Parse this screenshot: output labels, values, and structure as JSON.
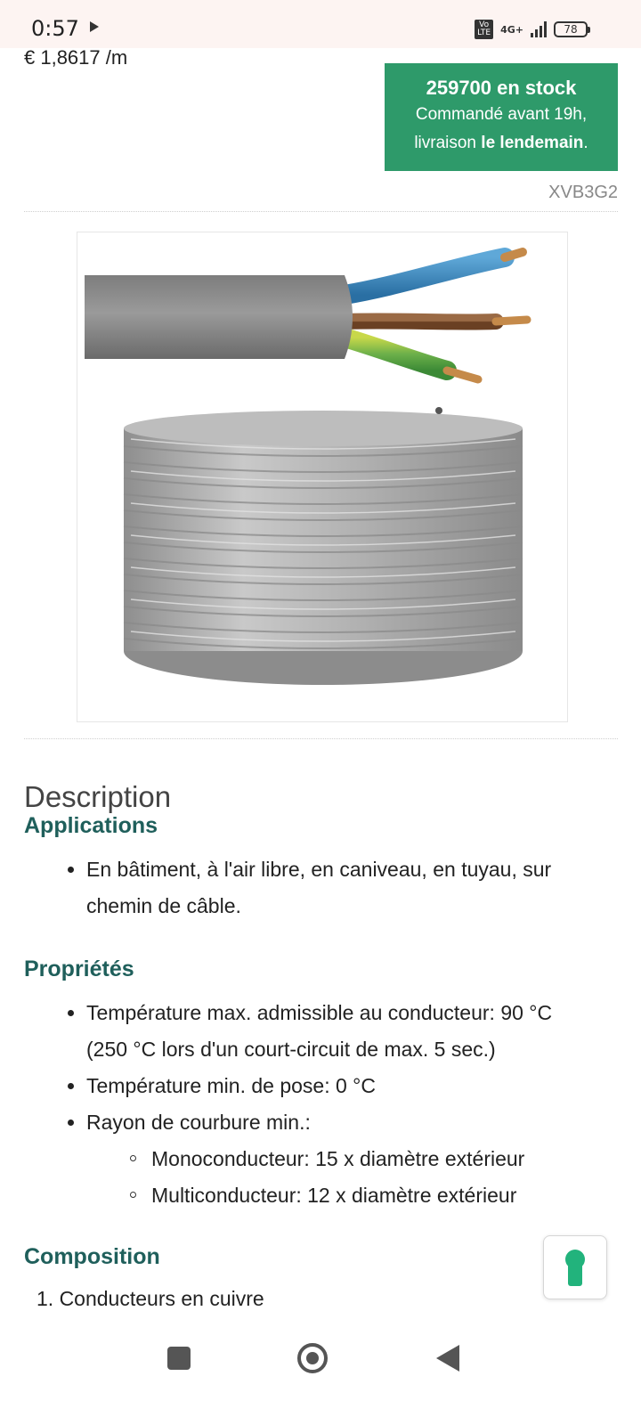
{
  "status_bar": {
    "time": "0:57",
    "volte_line1": "Vo",
    "volte_line2": "LTE",
    "network": "4G+",
    "battery": "78"
  },
  "product": {
    "price": "€ 1,8617 /m",
    "stock_count": "259700 en stock",
    "stock_line1": "Commandé avant 19h,",
    "stock_line2_prefix": "livraison ",
    "stock_line2_bold": "le lendemain",
    "stock_line2_suffix": ".",
    "sku": "XVB3G2",
    "image_icon": "cable-coil-photo"
  },
  "description": {
    "title": "Description",
    "applications": {
      "heading": "Applications",
      "items": [
        "En bâtiment, à l'air libre, en caniveau, en tuyau, sur",
        "chemin de câble."
      ]
    },
    "proprietes": {
      "heading": "Propriétés",
      "items": [
        "Température max. admissible au conducteur: 90 °C",
        "(250 °C lors d'un court-circuit de max. 5 sec.)",
        "Température min. de pose: 0 °C",
        "Rayon de courbure min.:"
      ],
      "sub_items": [
        "Monoconducteur: 15 x diamètre extérieur",
        "Multiconducteur: 12 x diamètre extérieur"
      ]
    },
    "composition": {
      "heading": "Composition",
      "items": [
        "1. Conducteurs en cuivre"
      ]
    }
  },
  "colors": {
    "stock_green": "#2e9a6a",
    "heading_teal": "#1f5f5b",
    "keyhole_green": "#22b37c"
  },
  "icons": {
    "chat": "keyhole-icon",
    "nav_recent": "square-icon",
    "nav_home": "circle-icon",
    "nav_back": "triangle-back-icon"
  }
}
